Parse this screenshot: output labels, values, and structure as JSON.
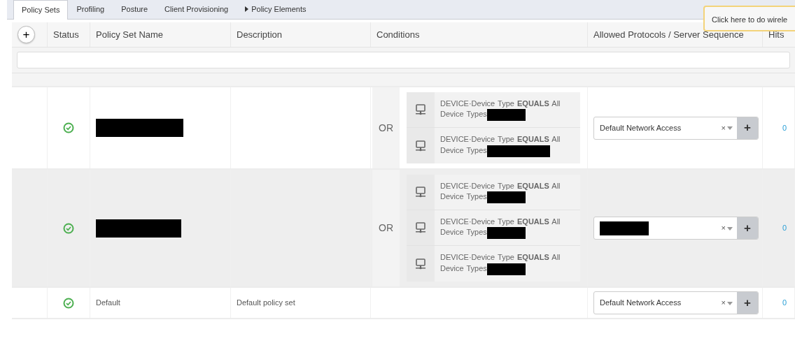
{
  "tabs": [
    {
      "label": "Policy Sets",
      "selected": true,
      "has_caret": false
    },
    {
      "label": "Profiling",
      "selected": false,
      "has_caret": false
    },
    {
      "label": "Posture",
      "selected": false,
      "has_caret": false
    },
    {
      "label": "Client Provisioning",
      "selected": false,
      "has_caret": false
    },
    {
      "label": "Policy Elements",
      "selected": false,
      "has_caret": true
    }
  ],
  "tooltip": "Click here to do wirele",
  "table": {
    "add_button": "+",
    "columns": [
      "Status",
      "Policy Set Name",
      "Description",
      "Conditions",
      "Allowed Protocols / Server Sequence",
      "Hits"
    ],
    "rows": [
      {
        "status_ok": true,
        "name": "",
        "name_redacted": true,
        "description": "",
        "highlighted": false,
        "operator": "OR",
        "conditions": [
          {
            "text": "DEVICE·Device Type **EQUALS** All Device Types",
            "value_redacted": true
          },
          {
            "text": "DEVICE·Device Type **EQUALS** All Device Types",
            "value_redacted": true
          }
        ],
        "protocol": "Default Network Access",
        "protocol_redacted": false,
        "clear": "×",
        "add": "+",
        "hits": "0"
      },
      {
        "status_ok": true,
        "name": "",
        "name_redacted": true,
        "description": "",
        "highlighted": true,
        "operator": "OR",
        "conditions": [
          {
            "text": "DEVICE·Device Type **EQUALS** All Device Types",
            "value_redacted": true
          },
          {
            "text": "DEVICE·Device Type **EQUALS** All Device Types",
            "value_redacted": true
          },
          {
            "text": "DEVICE·Device Type **EQUALS** All Device Types",
            "value_redacted": true
          }
        ],
        "protocol": "",
        "protocol_redacted": true,
        "clear": "×",
        "add": "+",
        "hits": "0"
      },
      {
        "status_ok": true,
        "name": "Default",
        "name_redacted": false,
        "description": "Default policy set",
        "highlighted": false,
        "operator": "",
        "conditions": [],
        "protocol": "Default Network Access",
        "protocol_redacted": false,
        "clear": "×",
        "add": "+",
        "hits": "0"
      }
    ]
  }
}
